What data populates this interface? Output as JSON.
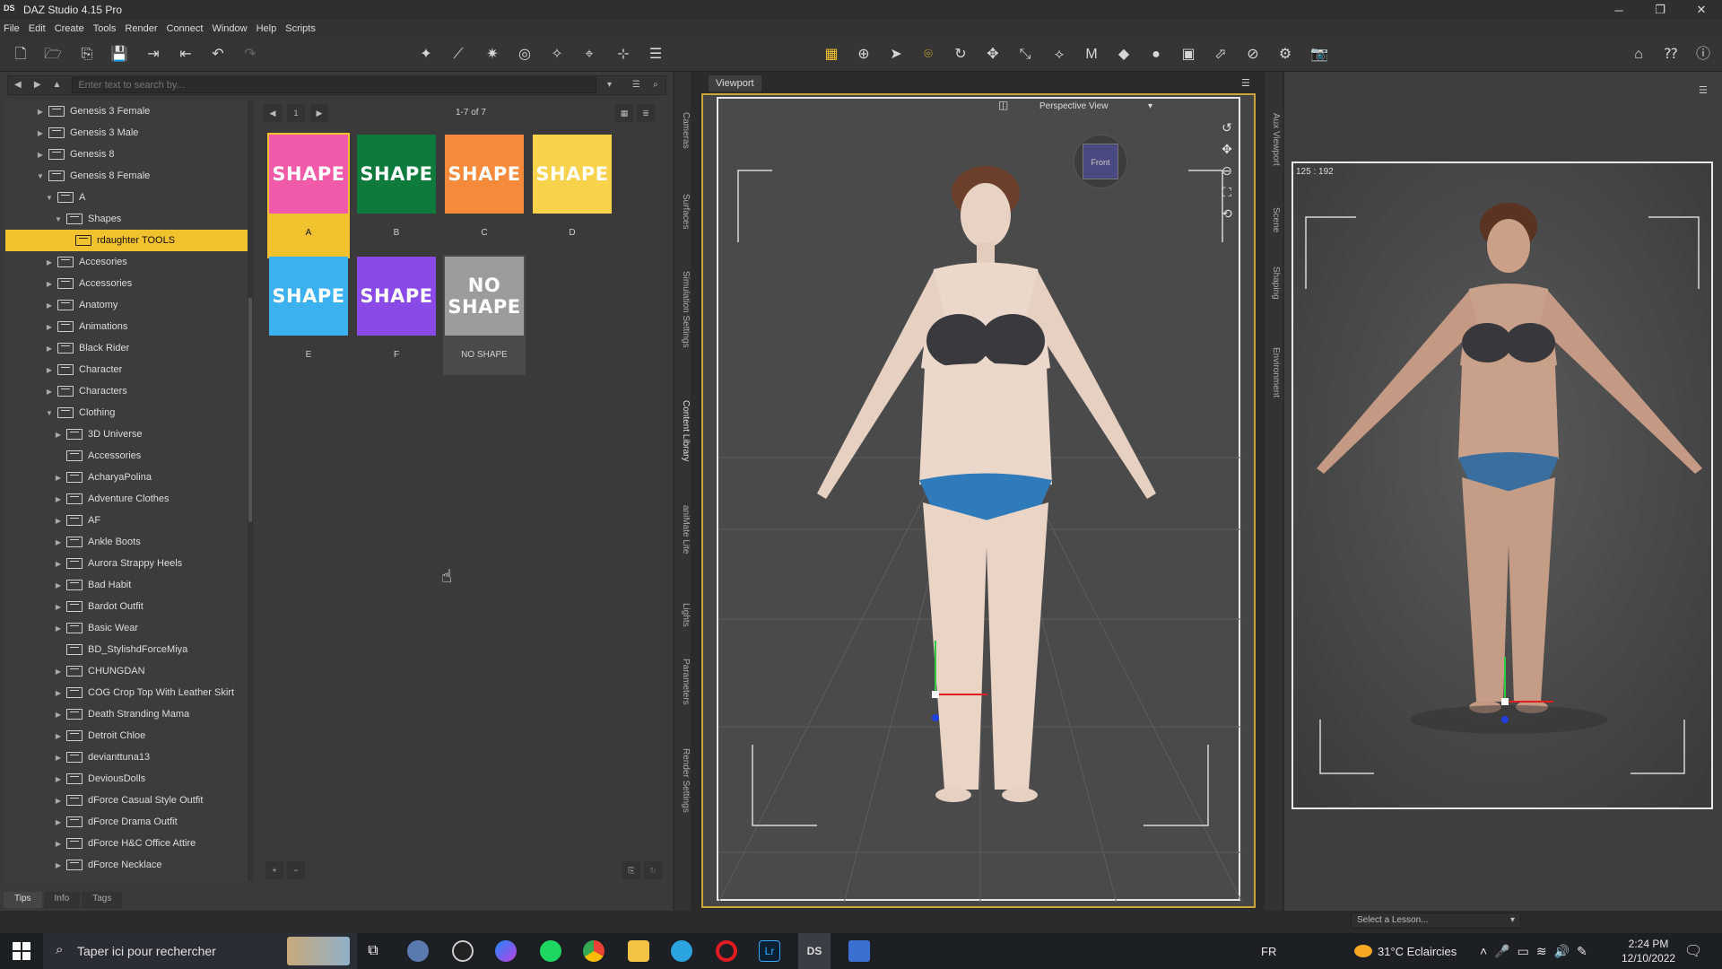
{
  "window": {
    "title": "DAZ Studio 4.15 Pro",
    "logo": "DS",
    "controls": [
      "minimize-icon",
      "restore-icon",
      "close-icon"
    ]
  },
  "menu": [
    "File",
    "Edit",
    "Create",
    "Tools",
    "Render",
    "Connect",
    "Window",
    "Help",
    "Scripts"
  ],
  "search": {
    "placeholder": "Enter text to search by..."
  },
  "tree": [
    {
      "label": "Genesis 3 Female",
      "depth": 2,
      "arrow": "right"
    },
    {
      "label": "Genesis 3 Male",
      "depth": 2,
      "arrow": "right"
    },
    {
      "label": "Genesis 8",
      "depth": 2,
      "arrow": "right"
    },
    {
      "label": "Genesis 8 Female",
      "depth": 2,
      "arrow": "down"
    },
    {
      "label": "A",
      "depth": 3,
      "arrow": "down"
    },
    {
      "label": "Shapes",
      "depth": 4,
      "arrow": "down"
    },
    {
      "label": "rdaughter TOOLS",
      "depth": 5,
      "arrow": "",
      "selected": true
    },
    {
      "label": "Accesories",
      "depth": 3,
      "arrow": "right"
    },
    {
      "label": "Accessories",
      "depth": 3,
      "arrow": "right"
    },
    {
      "label": "Anatomy",
      "depth": 3,
      "arrow": "right"
    },
    {
      "label": "Animations",
      "depth": 3,
      "arrow": "right"
    },
    {
      "label": "Black Rider",
      "depth": 3,
      "arrow": "right"
    },
    {
      "label": "Character",
      "depth": 3,
      "arrow": "right"
    },
    {
      "label": "Characters",
      "depth": 3,
      "arrow": "right"
    },
    {
      "label": "Clothing",
      "depth": 3,
      "arrow": "down"
    },
    {
      "label": "3D Universe",
      "depth": 4,
      "arrow": "right"
    },
    {
      "label": "Accessories",
      "depth": 4,
      "arrow": ""
    },
    {
      "label": "AcharyaPolina",
      "depth": 4,
      "arrow": "right"
    },
    {
      "label": "Adventure Clothes",
      "depth": 4,
      "arrow": "right"
    },
    {
      "label": "AF",
      "depth": 4,
      "arrow": "right"
    },
    {
      "label": "Ankle Boots",
      "depth": 4,
      "arrow": "right"
    },
    {
      "label": "Aurora Strappy Heels",
      "depth": 4,
      "arrow": "right"
    },
    {
      "label": "Bad Habit",
      "depth": 4,
      "arrow": "right"
    },
    {
      "label": "Bardot Outfit",
      "depth": 4,
      "arrow": "right"
    },
    {
      "label": "Basic Wear",
      "depth": 4,
      "arrow": "right"
    },
    {
      "label": "BD_StylishdForceMiya",
      "depth": 4,
      "arrow": ""
    },
    {
      "label": "CHUNGDAN",
      "depth": 4,
      "arrow": "right"
    },
    {
      "label": "COG Crop Top With Leather Skirt",
      "depth": 4,
      "arrow": "right"
    },
    {
      "label": "Death Stranding Mama",
      "depth": 4,
      "arrow": "right"
    },
    {
      "label": "Detroit Chloe",
      "depth": 4,
      "arrow": "right"
    },
    {
      "label": "devianttuna13",
      "depth": 4,
      "arrow": "right"
    },
    {
      "label": "DeviousDolls",
      "depth": 4,
      "arrow": "right"
    },
    {
      "label": "dForce Casual Style Outfit",
      "depth": 4,
      "arrow": "right"
    },
    {
      "label": "dForce Drama Outfit",
      "depth": 4,
      "arrow": "right"
    },
    {
      "label": "dForce H&C Office Attire",
      "depth": 4,
      "arrow": "right"
    },
    {
      "label": "dForce Necklace",
      "depth": 4,
      "arrow": "right"
    }
  ],
  "content": {
    "page": "1",
    "count": "1-7 of 7",
    "tiles": [
      {
        "line1": "SHAPE",
        "line2": "",
        "label": "A",
        "color": "#f05aa8",
        "active": true
      },
      {
        "line1": "SHAPE",
        "line2": "",
        "label": "B",
        "color": "#0e7a3c"
      },
      {
        "line1": "SHAPE",
        "line2": "",
        "label": "C",
        "color": "#f58a3a"
      },
      {
        "line1": "SHAPE",
        "line2": "",
        "label": "D",
        "color": "#f7d24a"
      },
      {
        "line1": "SHAPE",
        "line2": "",
        "label": "E",
        "color": "#3cb1f0"
      },
      {
        "line1": "SHAPE",
        "line2": "",
        "label": "F",
        "color": "#8a4ae8"
      },
      {
        "line1": "NO",
        "line2": "SHAPE",
        "label": "NO SHAPE",
        "color": "#9c9c9c"
      }
    ]
  },
  "bottom_tabs": [
    "Tips",
    "Info",
    "Tags"
  ],
  "side_tabs": [
    "Cameras",
    "Surfaces",
    "Simulation Settings",
    "Content Library",
    "aniMate Lite",
    "Lights",
    "Parameters",
    "Render Settings"
  ],
  "viewport": {
    "tab": "Viewport",
    "view_mode": "Perspective View",
    "cube_label": "Front"
  },
  "aux_tabs": [
    "Aux Viewport",
    "Scene",
    "Shaping",
    "Environment"
  ],
  "aux": {
    "ratio": "125 : 192"
  },
  "lesson": {
    "placeholder": "Select a Lesson..."
  },
  "taskbar": {
    "search_placeholder": "Taper ici pour rechercher",
    "language": "FR",
    "weather": "31°C  Eclaircies",
    "time": "2:24 PM",
    "date": "12/10/2022",
    "apps": [
      "task-view-icon",
      "app-icon",
      "obs-icon",
      "messenger-icon",
      "spotify-icon",
      "chrome-icon",
      "file-explorer-icon",
      "telegram-icon",
      "opera-icon",
      "lightroom-icon",
      "daz-studio-icon",
      "calculator-icon"
    ]
  }
}
